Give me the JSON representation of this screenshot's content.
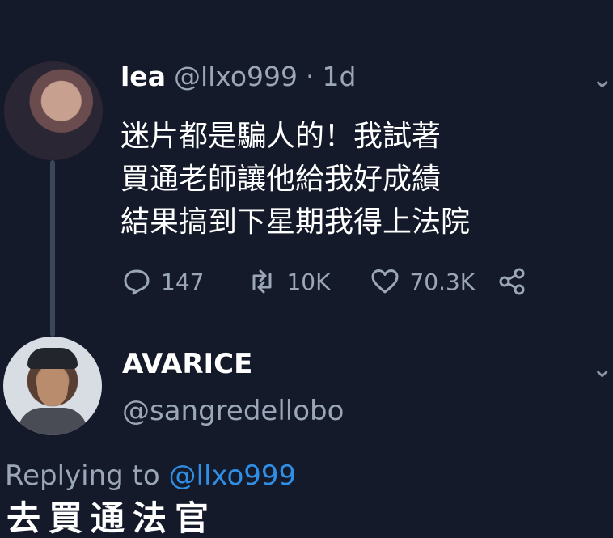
{
  "tweet": {
    "name": "lea",
    "handle": "@llxo999",
    "separator": "·",
    "time": "1d",
    "text": "迷片都是騙人的！我試著\n買通老師讓他給我好成績\n結果搞到下星期我得上法院",
    "reply_count": "147",
    "retweet_count": "10K",
    "like_count": "70.3K"
  },
  "reply": {
    "name": "AVARICE",
    "handle": "@sangredellobo",
    "replying_prefix": "Replying to ",
    "replying_mention": "@llxo999",
    "partial_text": "去買通法官"
  },
  "icons": {
    "reply": "reply-icon",
    "retweet": "retweet-icon",
    "like": "heart-icon",
    "share": "share-icon",
    "more": "chevron-down-icon"
  },
  "colors": {
    "background": "#141a2a",
    "muted": "#9ba7b7",
    "link": "#2f8fe6"
  }
}
